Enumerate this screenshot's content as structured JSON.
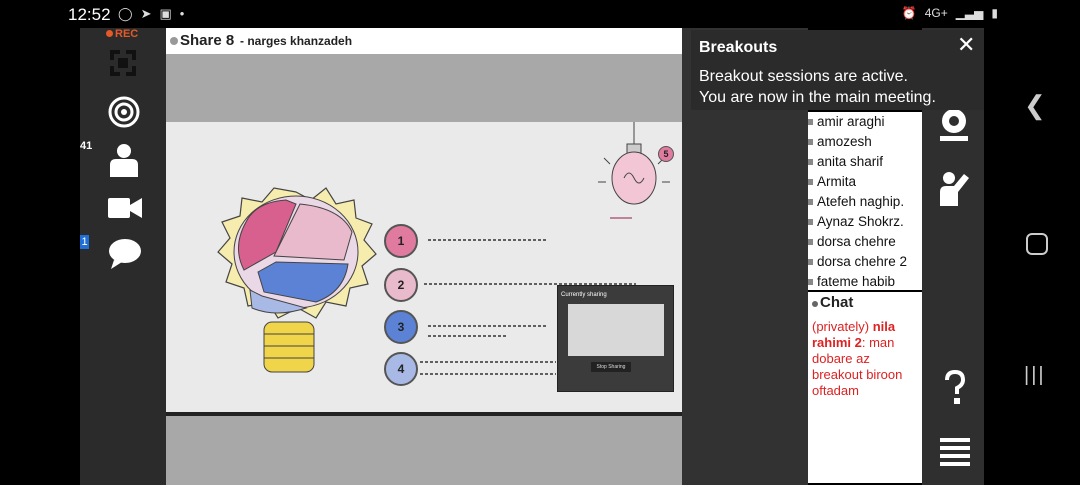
{
  "status_bar": {
    "time": "12:52",
    "network": "4G+"
  },
  "left_toolbar": {
    "rec_label": "REC",
    "participant_count": "41",
    "chat_badge": "1"
  },
  "share": {
    "title": "Share 8",
    "subtitle": "- narges khanzadeh"
  },
  "slide": {
    "numbers": [
      "1",
      "2",
      "3",
      "4"
    ],
    "badge": "5"
  },
  "pip": {
    "title": "Currently sharing",
    "button": "Stop Sharing"
  },
  "breakouts": {
    "title": "Breakouts",
    "line1": "Breakout sessions are active.",
    "line2": "You are now in the main meeting."
  },
  "users": [
    "amir araghi",
    "amozesh",
    "anita sharif",
    "Armita",
    "Atefeh naghip.",
    "Aynaz Shokrz.",
    "dorsa chehre",
    "dorsa chehre 2",
    "fateme habib"
  ],
  "chat": {
    "title": "Chat",
    "prefix": "(privately)",
    "sender": "nila rahimi 2",
    "message": ": man dobare az breakout biroon oftadam"
  },
  "colors": {
    "rec": "#e3592a",
    "chat_text": "#dd2222",
    "panel_dark": "#2b2b2b"
  }
}
